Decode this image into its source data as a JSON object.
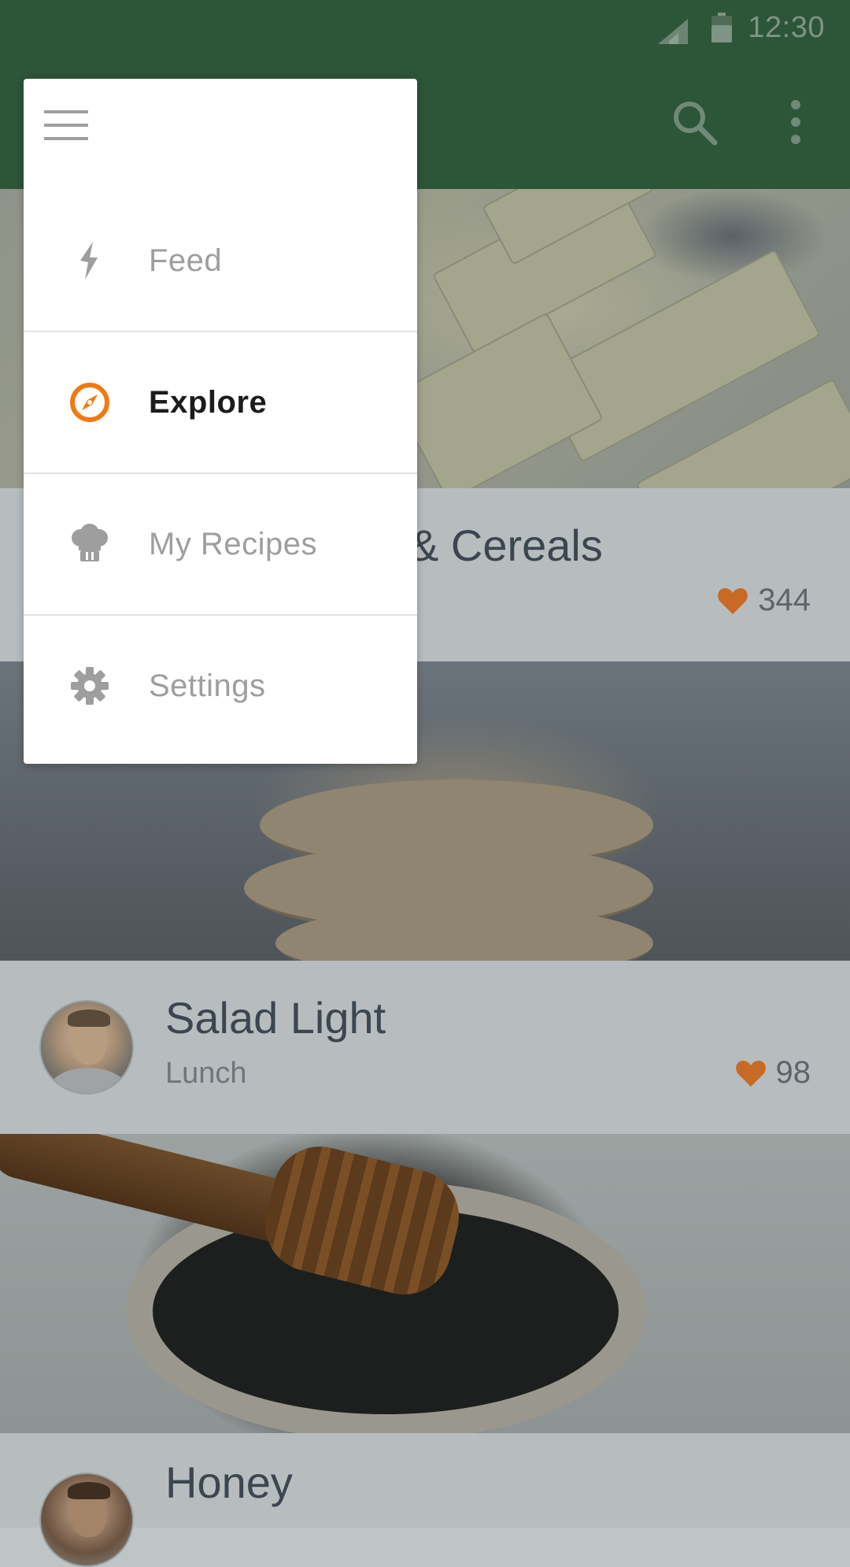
{
  "status_bar": {
    "time": "12:30",
    "icons": [
      "signal-icon",
      "battery-icon"
    ]
  },
  "app_bar": {
    "icons": [
      "search-icon",
      "more-vert-icon"
    ]
  },
  "drawer": {
    "icons": [
      "menu-icon"
    ],
    "items": [
      {
        "label": "Feed",
        "icon": "lightning-icon",
        "active": false
      },
      {
        "label": "Explore",
        "icon": "compass-icon",
        "active": true
      },
      {
        "label": "My Recipes",
        "icon": "chef-hat-icon",
        "active": false
      },
      {
        "label": "Settings",
        "icon": "gear-icon",
        "active": false
      }
    ]
  },
  "feed": {
    "cards": [
      {
        "title": "& Cereals",
        "subtitle": "",
        "likes": "344",
        "image": "cheese-photo"
      },
      {
        "title": "Salad Light",
        "subtitle": "Lunch",
        "likes": "98",
        "image": "cookies-photo"
      },
      {
        "title": "Honey",
        "subtitle": "",
        "likes": "",
        "image": "honey-photo"
      }
    ]
  },
  "colors": {
    "app_bar": "#2d5538",
    "accent_active": "#f07a12",
    "heart": "#c76a25",
    "drawer_bg": "#ffffff",
    "inactive_text": "#9e9e9e",
    "active_text": "#1c1c1c"
  }
}
